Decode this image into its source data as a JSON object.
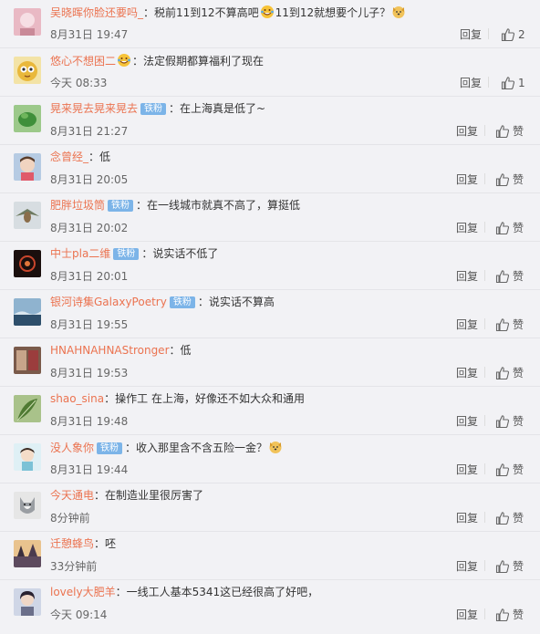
{
  "comments": [
    {
      "user": "吴晓晖你脸还要吗_",
      "badge": "",
      "sep": "：",
      "text_a": "税前11到12不算高吧",
      "text_b": "11到12就想要个儿子？",
      "time": "8月31日 19:47",
      "reply": "回复",
      "like": "2",
      "emoji_a": "laugh-cry-emoji",
      "emoji_b": "dog-face-emoji"
    },
    {
      "user": "悠心不想困二",
      "badge": "",
      "sep": "：",
      "text_a": "法定假期都算福利了现在",
      "text_b": "",
      "time": "今天 08:33",
      "reply": "回复",
      "like": "1",
      "emoji_a": "laugh-cry-emoji"
    },
    {
      "user": "晃来晃去晃来晃去",
      "badge": "铁粉",
      "sep": "：",
      "text_a": "在上海真是低了~",
      "text_b": "",
      "time": "8月31日 21:27",
      "reply": "回复",
      "like": "赞"
    },
    {
      "user": "念曾经_",
      "badge": "",
      "sep": "：",
      "text_a": "低",
      "text_b": "",
      "time": "8月31日 20:05",
      "reply": "回复",
      "like": "赞"
    },
    {
      "user": "肥胖垃圾筒",
      "badge": "铁粉",
      "sep": "：",
      "text_a": "在一线城市就真不高了，算挺低",
      "text_b": "",
      "time": "8月31日 20:02",
      "reply": "回复",
      "like": "赞"
    },
    {
      "user": "中士pla二维",
      "badge": "铁粉",
      "sep": "：",
      "text_a": "说实话不低了",
      "text_b": "",
      "time": "8月31日 20:01",
      "reply": "回复",
      "like": "赞"
    },
    {
      "user": "银河诗集GalaxyPoetry",
      "badge": "铁粉",
      "sep": "：",
      "text_a": "说实话不算高",
      "text_b": "",
      "time": "8月31日 19:55",
      "reply": "回复",
      "like": "赞"
    },
    {
      "user": "HNAHNAHNAStronger",
      "badge": "",
      "sep": "：",
      "text_a": "低",
      "text_b": "",
      "time": "8月31日 19:53",
      "reply": "回复",
      "like": "赞"
    },
    {
      "user": "shao_sina",
      "badge": "",
      "sep": "：",
      "text_a": "操作工 在上海，好像还不如大众和通用",
      "text_b": "",
      "time": "8月31日 19:48",
      "reply": "回复",
      "like": "赞"
    },
    {
      "user": "没人象你",
      "badge": "铁粉",
      "sep": "：",
      "text_a": "收入那里含不含五险一金？",
      "text_b": "",
      "time": "8月31日 19:44",
      "reply": "回复",
      "like": "赞",
      "emoji_b": "dog-face-emoji"
    },
    {
      "user": "今天通电",
      "badge": "",
      "sep": "：",
      "text_a": "在制造业里很厉害了",
      "text_b": "",
      "time": "8分钟前",
      "reply": "回复",
      "like": "赞"
    },
    {
      "user": "迁憩蜂鸟",
      "badge": "",
      "sep": "：",
      "text_a": "呸",
      "text_b": "",
      "time": "33分钟前",
      "reply": "回复",
      "like": "赞"
    },
    {
      "user": "lovely大肥羊",
      "badge": "",
      "sep": "：",
      "text_a": "一线工人基本5341这已经很高了好吧，",
      "text_b": "",
      "time": "今天 09:14",
      "reply": "回复",
      "like": "赞"
    }
  ],
  "colors": {
    "username": "#eb7350",
    "badge": "#7cb4e8",
    "background": "#f2f2f5"
  },
  "icons": {
    "like": "thumbs-up-icon"
  }
}
